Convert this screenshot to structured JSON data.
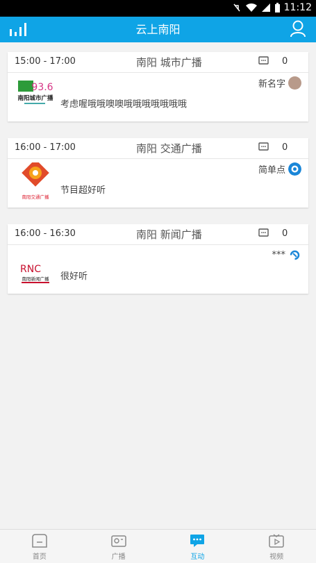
{
  "status_bar": {
    "time": "11:12"
  },
  "app_bar": {
    "title": "云上南阳"
  },
  "posts": [
    {
      "time": "15:00 - 17:00",
      "station": "南阳 城市广播",
      "comment_count": "0",
      "user": "新名字",
      "comment": "考虑喔哦哦噢噢哦哦哦哦哦哦哦",
      "logo_text": "南阳城市广播",
      "logo_freq": "93.6"
    },
    {
      "time": "16:00 - 17:00",
      "station": "南阳 交通广播",
      "comment_count": "0",
      "user": "简单点",
      "comment": "节目超好听",
      "logo_text": "南阳交通广播"
    },
    {
      "time": "16:00 - 16:30",
      "station": "南阳 新闻广播",
      "comment_count": "0",
      "user": "***",
      "comment": "很好听",
      "logo_text": "南阳新闻广播",
      "logo_mark": "RNC"
    }
  ],
  "bottom_nav": [
    {
      "label": "首页",
      "icon": "home-icon",
      "active": false
    },
    {
      "label": "广播",
      "icon": "radio-icon",
      "active": false
    },
    {
      "label": "互动",
      "icon": "chat-icon",
      "active": true
    },
    {
      "label": "视频",
      "icon": "video-icon",
      "active": false
    }
  ],
  "colors": {
    "accent": "#0fa4e6",
    "status_bar": "#000000",
    "background": "#f2f2f2"
  }
}
